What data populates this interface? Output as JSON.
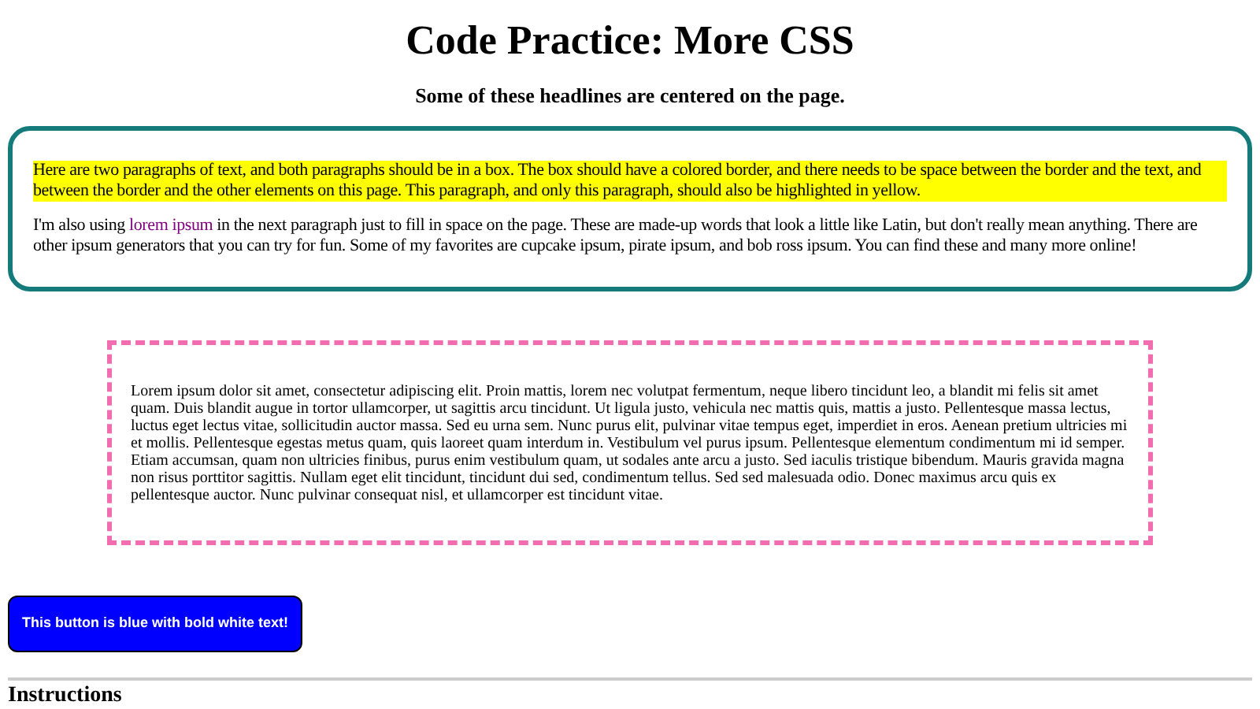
{
  "title": "Code Practice: More CSS",
  "subtitle": "Some of these headlines are centered on the page.",
  "box": {
    "highlighted_paragraph": "Here are two paragraphs of text, and both paragraphs should be in a box. The box should have a colored border, and there needs to be space between the border and the text, and between the border and the other elements on this page. This paragraph, and only this paragraph, should also be highlighted in yellow.",
    "paragraph": {
      "before": "I'm also using ",
      "link": "lorem ipsum",
      "after": " in the next paragraph just to fill in space on the page. These are made-up words that look a little like Latin, but don't really mean anything. There are other ipsum generators that you can try for fun. Some of my favorites are cupcake ipsum, pirate ipsum, and bob ross ipsum. You can find these and many more online!"
    }
  },
  "dashed_box": {
    "paragraph": "Lorem ipsum dolor sit amet, consectetur adipiscing elit. Proin mattis, lorem nec volutpat fermentum, neque libero tincidunt leo, a blandit mi felis sit amet quam. Duis blandit augue in tortor ullamcorper, ut sagittis arcu tincidunt. Ut ligula justo, vehicula nec mattis quis, mattis a justo. Pellentesque massa lectus, luctus eget lectus vitae, sollicitudin auctor massa. Sed eu urna sem. Nunc purus elit, pulvinar vitae tempus eget, imperdiet in eros. Aenean pretium ultricies mi et mollis. Pellentesque egestas metus quam, quis laoreet quam interdum in. Vestibulum vel purus ipsum. Pellentesque elementum condimentum mi id semper. Etiam accumsan, quam non ultricies finibus, purus enim vestibulum quam, ut sodales ante arcu a justo. Sed iaculis tristique bibendum. Mauris gravida magna non risus porttitor sagittis. Nullam eget elit tincidunt, tincidunt dui sed, condimentum tellus. Sed sed malesuada odio. Donec maximus arcu quis ex pellentesque auctor. Nunc pulvinar consequat nisl, et ullamcorper est tincidunt vitae."
  },
  "button": "This button is blue with bold white text!",
  "instructions_heading": "Instructions"
}
